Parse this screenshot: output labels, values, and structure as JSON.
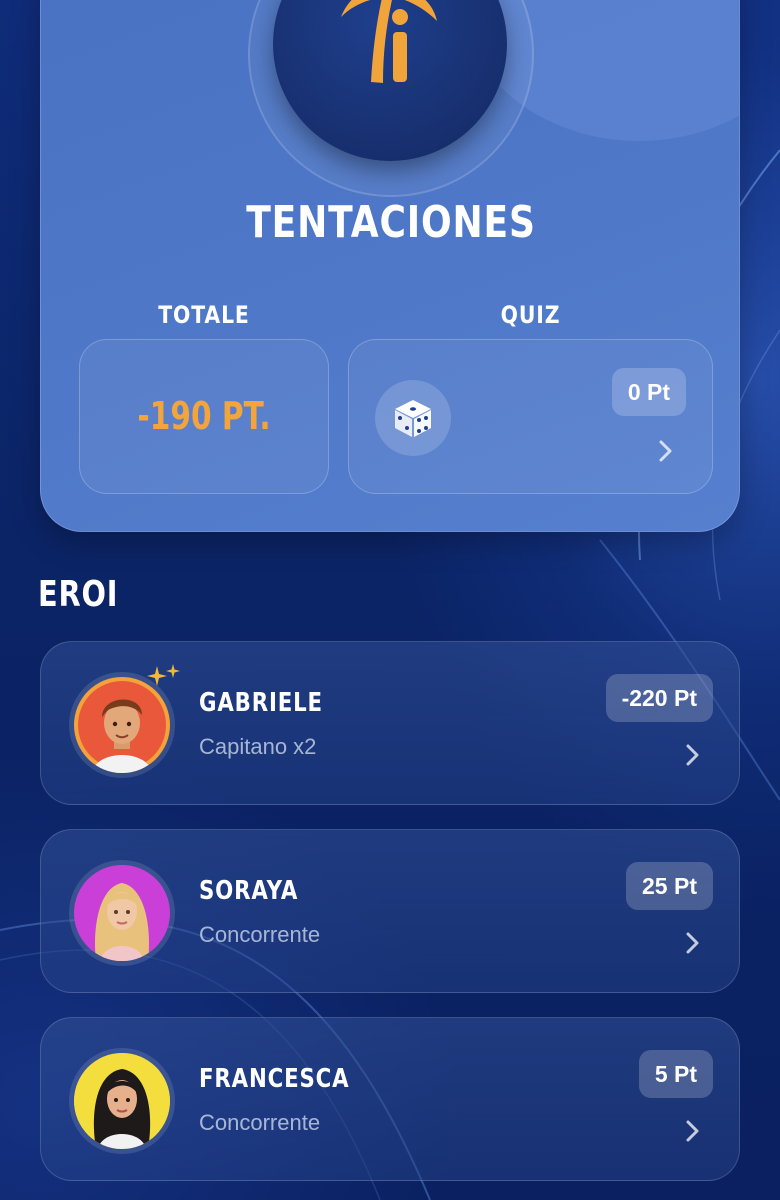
{
  "hero_card": {
    "title": "TENTACIONES",
    "totale_label": "TOTALE",
    "totale_value": "-190 PT.",
    "quiz_label": "QUIZ",
    "quiz_points": "0 Pt"
  },
  "section_title": "EROI",
  "heroes": [
    {
      "name": "GABRIELE",
      "role": "Capitano x2",
      "points": "-220 Pt"
    },
    {
      "name": "SORAYA",
      "role": "Concorrente",
      "points": "25 Pt"
    },
    {
      "name": "FRANCESCA",
      "role": "Concorrente",
      "points": "5 Pt"
    }
  ],
  "colors": {
    "accent_orange": "#f3a43a",
    "background": "#0b2466",
    "card": "#4f78c8"
  },
  "icons": [
    "palm-tree-logo-icon",
    "dice-icon",
    "chevron-right-icon",
    "sparkle-icon",
    "avatar-image"
  ]
}
